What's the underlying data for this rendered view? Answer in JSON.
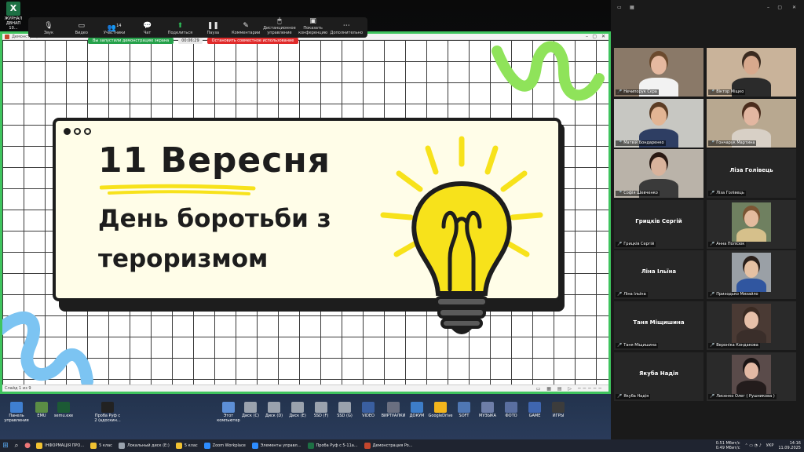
{
  "desktop": {
    "excel_shortcut_label": "ЖУРНАЛ ДВНАП 10...",
    "icons": [
      {
        "label": "Панель управления",
        "icon": "control-panel-icon",
        "color": "#3f7fd0"
      },
      {
        "label": "EMU",
        "icon": "emu-icon",
        "color": "#5b8d45"
      },
      {
        "label": "semu.exe",
        "icon": "semu-icon",
        "color": "#1c5a35"
      },
      {
        "label": "Проба Руф с 2 (адоскин...",
        "icon": "video-icon",
        "color": "#222222"
      },
      {
        "label": "Этот компьютер",
        "icon": "computer-icon",
        "color": "#5d8fd6"
      },
      {
        "label": "Диск (C)",
        "icon": "disk-icon",
        "color": "#9aa2ad"
      },
      {
        "label": "Диск (D)",
        "icon": "disk-icon",
        "color": "#9aa2ad"
      },
      {
        "label": "Диск (E)",
        "icon": "disk-icon",
        "color": "#9aa2ad"
      },
      {
        "label": "SSD (F)",
        "icon": "disk-icon",
        "color": "#9aa2ad"
      },
      {
        "label": "SSD (G)",
        "icon": "disk-icon",
        "color": "#9aa2ad"
      },
      {
        "label": "VIDEO",
        "icon": "folder-video-icon",
        "color": "#3a5fa0"
      },
      {
        "label": "ВИРТУАЛКИ",
        "icon": "folder-icon",
        "color": "#6a6f80"
      },
      {
        "label": "ДОКУМ",
        "icon": "folder-icon",
        "color": "#3d7dc8"
      },
      {
        "label": "GoogleDrive",
        "icon": "google-drive-icon",
        "color": "#f2b51c"
      },
      {
        "label": "SOFT",
        "icon": "folder-icon",
        "color": "#4f77b3"
      },
      {
        "label": "МУЗЫКА",
        "icon": "folder-music-icon",
        "color": "#6e7ea8"
      },
      {
        "label": "ФОТО",
        "icon": "folder-photo-icon",
        "color": "#5a6fa0"
      },
      {
        "label": "GAME",
        "icon": "folder-game-icon",
        "color": "#3f66b0"
      },
      {
        "label": "ИГРЫ",
        "icon": "folder-game-icon",
        "color": "#3c3c3c"
      }
    ]
  },
  "zoom_toolbar": {
    "buttons": [
      {
        "label": "Звук",
        "icon": "microphone-icon",
        "glyph": "🎙"
      },
      {
        "label": "Видео",
        "icon": "video-camera-icon",
        "glyph": "▭"
      },
      {
        "label": "Участники",
        "icon": "participants-icon",
        "glyph": "👥",
        "count": "14"
      },
      {
        "label": "Чат",
        "icon": "chat-icon",
        "glyph": "💬"
      },
      {
        "label": "Поделиться",
        "icon": "share-icon",
        "glyph": "⬆"
      },
      {
        "label": "Пауза",
        "icon": "pause-icon",
        "glyph": "❚❚"
      },
      {
        "label": "Комментарии",
        "icon": "annotate-icon",
        "glyph": "✎"
      },
      {
        "label": "Дистанционное управление",
        "icon": "remote-control-icon",
        "glyph": "🖱"
      },
      {
        "label": "Показать конференцию",
        "icon": "show-meeting-icon",
        "glyph": "▣"
      },
      {
        "label": "Дополнительно",
        "icon": "more-icon",
        "glyph": "⋯"
      }
    ]
  },
  "share_banner": {
    "sharing_text": "Вы запустили демонстрацию экрана",
    "timer": "00:06:29",
    "stop_label": "Остановить совместное использование"
  },
  "powerpoint": {
    "title": "Демонстрация PowerPoint",
    "status_text": "Слайд 1 из 9"
  },
  "slide": {
    "date": "11 Вересня",
    "subtitle": "День боротьби з тероризмом",
    "colors": {
      "accent_yellow": "#f7e21b",
      "squiggle_green": "#8fe35a",
      "squiggle_blue": "#7cc4f2",
      "ink": "#1d1d1d"
    }
  },
  "gallery": {
    "participants": [
      {
        "name": "Нечипорук Сєра",
        "has_video": true,
        "skin": "#e6b9a0",
        "hair": "#6b4a2e",
        "bg": "#8a7968",
        "shirt": "#f2f2f2"
      },
      {
        "name": "Віктор Міщко",
        "has_video": true,
        "skin": "#d8a98d",
        "hair": "#3a2a1f",
        "bg": "#c9b39a",
        "shirt": "#2b2b2b"
      },
      {
        "name": "Матвій Бондаренко",
        "has_video": true,
        "active": true,
        "skin": "#e2b594",
        "hair": "#5c3d25",
        "bg": "#c7c7c2",
        "shirt": "#2e3e63"
      },
      {
        "name": "Гончарук Мартина",
        "has_video": true,
        "skin": "#e3b7a1",
        "hair": "#4a2c1c",
        "bg": "#b8a890",
        "shirt": "#d8d0c6"
      },
      {
        "name": "Софія Шевченко",
        "has_video": true,
        "skin": "#d9b39c",
        "hair": "#2a1a14",
        "bg": "#bab3a9",
        "shirt": "#3a3a3a"
      },
      {
        "name": "Ліза Голівець",
        "has_video": false
      },
      {
        "name": "Грицків Сергій",
        "has_video": false
      },
      {
        "name": "Анна Полісюк",
        "has_video": true,
        "portrait": true,
        "skin": "#e4bb9e",
        "hair": "#7b5533",
        "bg": "#6f8060",
        "shirt": "#d6c08b"
      },
      {
        "name": "Ліна Ільїна",
        "has_video": false
      },
      {
        "name": "Приходько Михайло",
        "has_video": true,
        "portrait": true,
        "skin": "#e6c1a3",
        "hair": "#2a1f1a",
        "bg": "#9aa0a6",
        "shirt": "#3056a0"
      },
      {
        "name": "Таня Міщишина",
        "has_video": false
      },
      {
        "name": "Вероніка Кондакова",
        "has_video": true,
        "portrait": true,
        "skin": "#e7c0a9",
        "hair": "#3a2a22",
        "bg": "#4a3a34",
        "shirt": "#3a2e2a"
      },
      {
        "name": "Якуба Надія",
        "has_video": false
      },
      {
        "name": "Лисенко Олег ( Рушникова )",
        "has_video": true,
        "portrait": true,
        "skin": "#e3b9a4",
        "hair": "#1a1414",
        "bg": "#5a4b4a",
        "shirt": "#231c1c"
      }
    ]
  },
  "taskbar": {
    "tasks": [
      {
        "label": "ІНФОРМАЦІЯ ПРО...",
        "icon": "folder-icon",
        "color": "#f1c232"
      },
      {
        "label": "5 клас",
        "icon": "folder-icon",
        "color": "#f1c232"
      },
      {
        "label": "Локальный диск (E:)",
        "icon": "disk-icon",
        "color": "#9aa2ad"
      },
      {
        "label": "5 клас",
        "icon": "folder-icon",
        "color": "#f1c232"
      },
      {
        "label": "Zoom Workplace",
        "icon": "zoom-icon",
        "color": "#2d8cff"
      },
      {
        "label": "Элементы управл...",
        "icon": "zoom-icon",
        "color": "#2d8cff"
      },
      {
        "label": "Проба Руф с 5-11а...",
        "icon": "excel-icon",
        "color": "#1d7044"
      },
      {
        "label": "Демонстрация Po...",
        "icon": "powerpoint-icon",
        "color": "#c5472d"
      }
    ],
    "net_up": "0.51 Мбит/с",
    "net_down": "0.49 Мбит/с",
    "lang": "УКР",
    "time": "14:16",
    "date": "11.09.2025"
  }
}
